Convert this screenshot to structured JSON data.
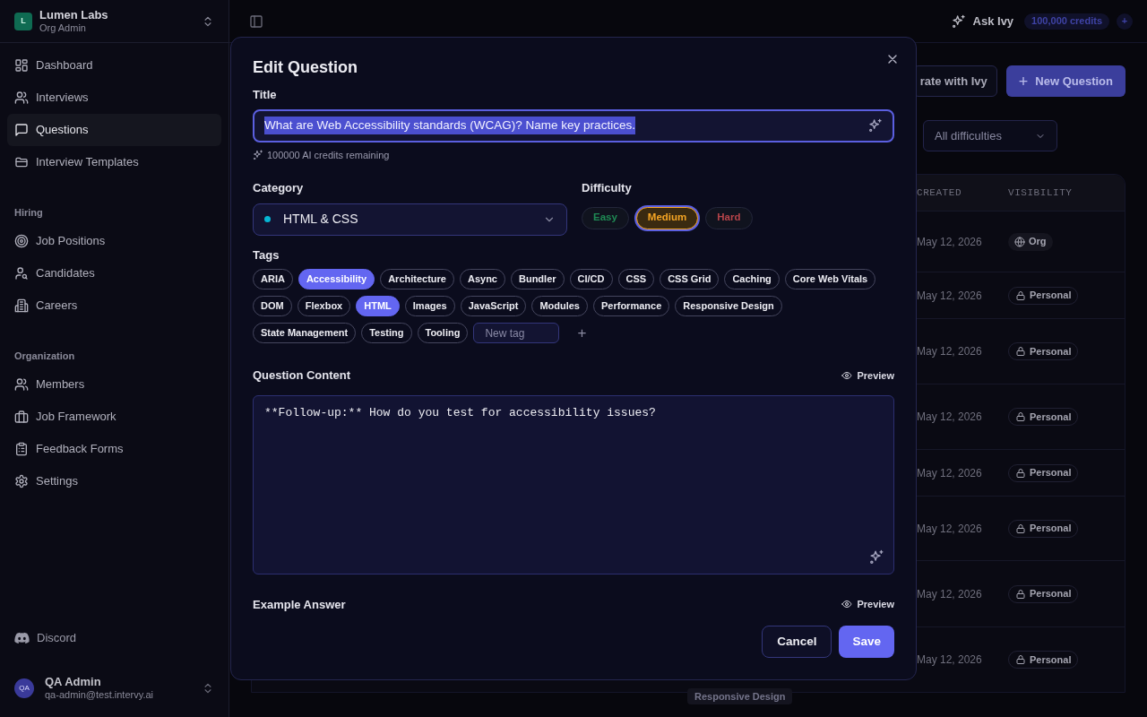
{
  "sidebar": {
    "org": {
      "initial": "L",
      "name": "Lumen Labs",
      "role": "Org Admin"
    },
    "sections": [
      {
        "items": [
          {
            "label": "Dashboard",
            "selected": false
          },
          {
            "label": "Interviews",
            "selected": false
          },
          {
            "label": "Questions",
            "selected": true
          },
          {
            "label": "Interview Templates",
            "selected": false
          }
        ]
      },
      {
        "heading": "Hiring",
        "items": [
          {
            "label": "Job Positions",
            "selected": false
          },
          {
            "label": "Candidates",
            "selected": false
          },
          {
            "label": "Careers",
            "selected": false
          }
        ]
      },
      {
        "heading": "Organization",
        "items": [
          {
            "label": "Members",
            "selected": false
          },
          {
            "label": "Job Framework",
            "selected": false
          },
          {
            "label": "Feedback Forms",
            "selected": false
          },
          {
            "label": "Settings",
            "selected": false
          }
        ]
      }
    ],
    "discord": "Discord",
    "user": {
      "initials": "QA",
      "name": "QA Admin",
      "email": "qa-admin@test.intervy.ai"
    }
  },
  "header": {
    "ask": "Ask Ivy",
    "credits": "100,000 credits",
    "add": "+"
  },
  "page": {
    "generate_button": "rate with Ivy",
    "new_button": "+",
    "new_button_label": "New Question",
    "difficulty_filter": "All difficulties",
    "table": {
      "columns": [
        "CREATED",
        "VISIBILITY"
      ],
      "rows": [
        {
          "created": "May 12, 2026",
          "visibility": "Org",
          "kind": "org"
        },
        {
          "created": "May 12, 2026",
          "visibility": "Personal",
          "kind": "personal"
        },
        {
          "created": "May 12, 2026",
          "visibility": "Personal",
          "kind": "personal"
        },
        {
          "created": "May 12, 2026",
          "visibility": "Personal",
          "kind": "personal"
        },
        {
          "created": "May 12, 2026",
          "visibility": "Personal",
          "kind": "personal"
        },
        {
          "created": "May 12, 2026",
          "visibility": "Personal",
          "kind": "personal"
        },
        {
          "created": "May 12, 2026",
          "visibility": "Personal",
          "kind": "personal"
        },
        {
          "created": "May 12, 2026",
          "visibility": "Personal",
          "kind": "personal",
          "tag": "Responsive Design"
        }
      ]
    }
  },
  "dialog": {
    "title": "Edit Question",
    "title_label": "Title",
    "title_value": "What are Web Accessibility standards (WCAG)? Name key practices.",
    "title_selected": true,
    "credits_note": "100000 AI credits remaining",
    "category_label": "Category",
    "category": {
      "value": "HTML & CSS",
      "color": "#06b6d4"
    },
    "difficulty_label": "Difficulty",
    "difficulties": [
      {
        "label": "Easy",
        "selected": false,
        "color": "#1f8a54"
      },
      {
        "label": "Medium",
        "selected": true,
        "color": "#f5a524"
      },
      {
        "label": "Hard",
        "selected": false,
        "color": "#b5444a"
      }
    ],
    "tags_label": "Tags",
    "tags": [
      {
        "label": "ARIA",
        "selected": false
      },
      {
        "label": "Accessibility",
        "selected": true
      },
      {
        "label": "Architecture",
        "selected": false
      },
      {
        "label": "Async",
        "selected": false
      },
      {
        "label": "Bundler",
        "selected": false
      },
      {
        "label": "CI/CD",
        "selected": false
      },
      {
        "label": "CSS",
        "selected": false
      },
      {
        "label": "CSS Grid",
        "selected": false
      },
      {
        "label": "Caching",
        "selected": false
      },
      {
        "label": "Core Web Vitals",
        "selected": false
      },
      {
        "label": "DOM",
        "selected": false
      },
      {
        "label": "Flexbox",
        "selected": false
      },
      {
        "label": "HTML",
        "selected": true
      },
      {
        "label": "Images",
        "selected": false
      },
      {
        "label": "JavaScript",
        "selected": false
      },
      {
        "label": "Modules",
        "selected": false
      },
      {
        "label": "Performance",
        "selected": false
      },
      {
        "label": "Responsive Design",
        "selected": false
      },
      {
        "label": "State Management",
        "selected": false
      },
      {
        "label": "Testing",
        "selected": false
      },
      {
        "label": "Tooling",
        "selected": false
      }
    ],
    "new_tag": {
      "placeholder": "New tag"
    },
    "add_tag": "+",
    "content_label": "Question Content",
    "content_preview": "Preview",
    "content_value": "**Follow-up:** How do you test for accessibility issues?",
    "answer_label": "Example Answer",
    "answer_preview": "Preview",
    "buttons": [
      "Cancel",
      "Save"
    ]
  }
}
